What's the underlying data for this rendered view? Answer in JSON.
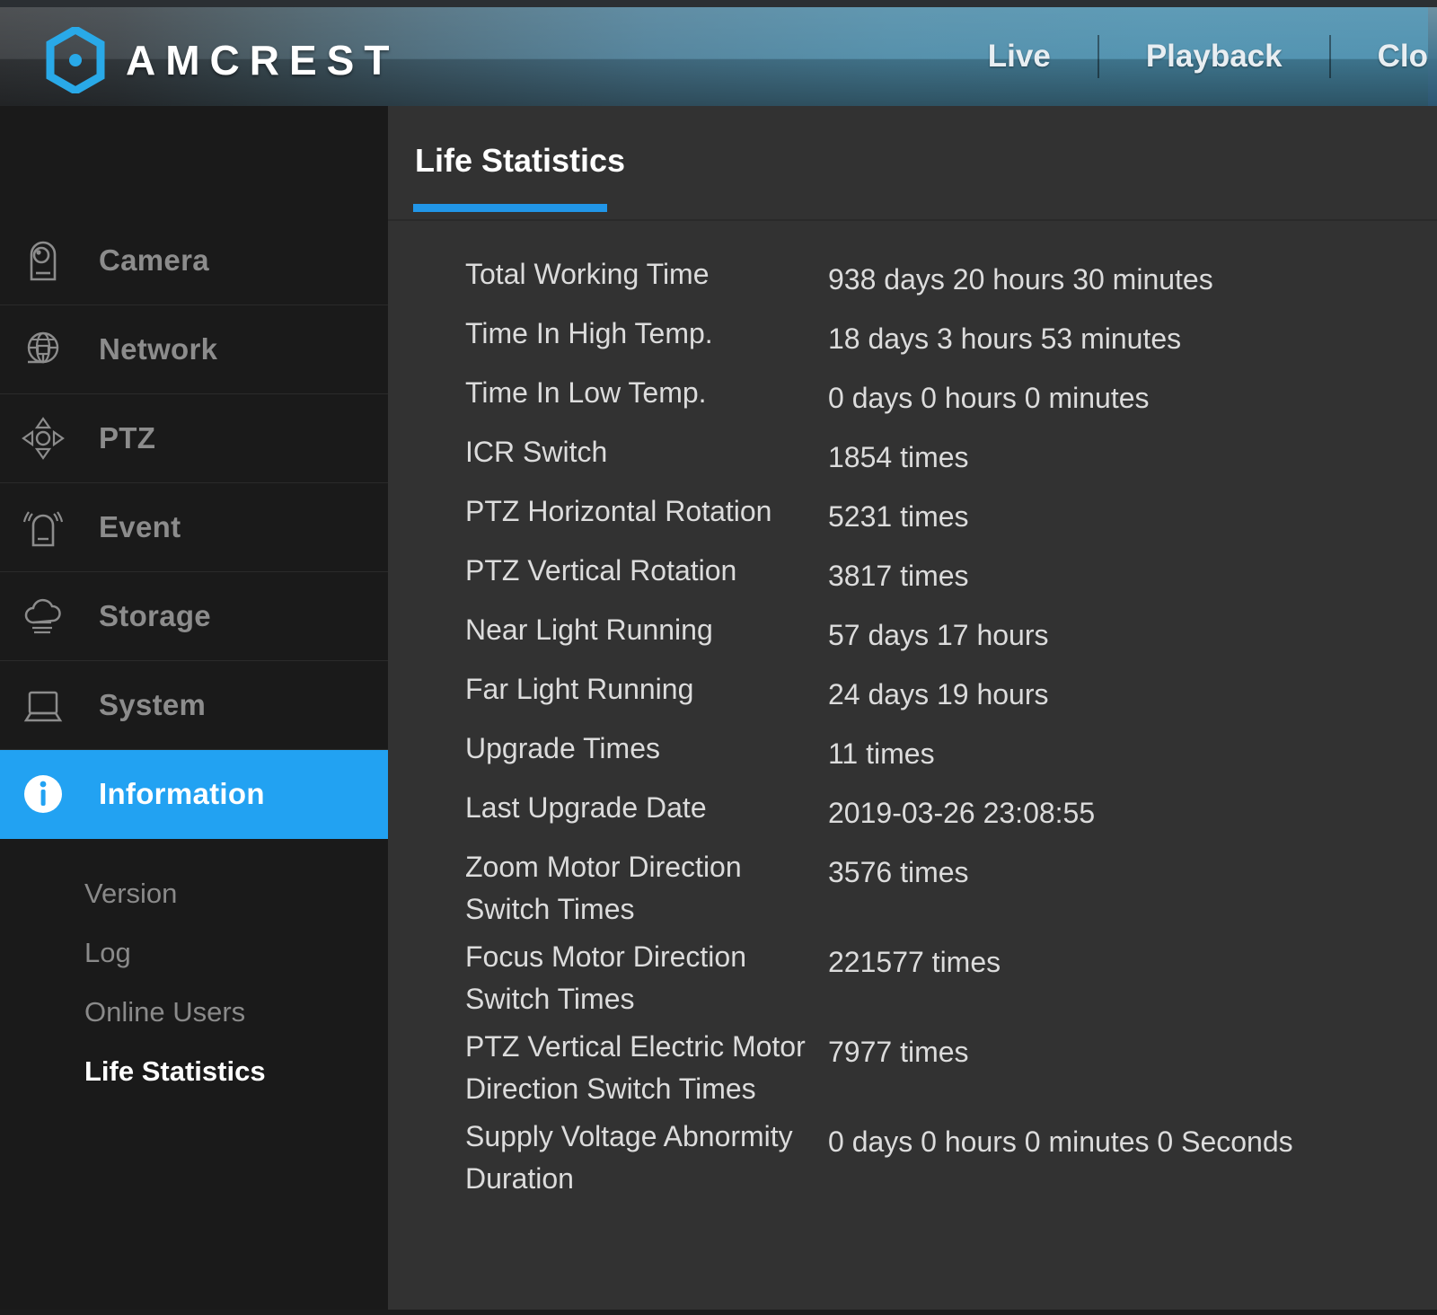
{
  "header": {
    "brand": "AMCREST",
    "logo_icon": "amcrest-hexagon-logo-icon",
    "nav": [
      {
        "label": "Live",
        "icon": "live-nav-item"
      },
      {
        "label": "Playback",
        "icon": "playback-nav-item"
      },
      {
        "label": "Clo",
        "icon": "cloud-nav-item"
      }
    ],
    "accent_color": "#22a2f2"
  },
  "sidebar": {
    "items": [
      {
        "label": "Camera",
        "icon": "camera-icon",
        "active": false
      },
      {
        "label": "Network",
        "icon": "globe-network-icon",
        "active": false
      },
      {
        "label": "PTZ",
        "icon": "ptz-directional-icon",
        "active": false
      },
      {
        "label": "Event",
        "icon": "alarm-bell-icon",
        "active": false
      },
      {
        "label": "Storage",
        "icon": "cloud-storage-icon",
        "active": false
      },
      {
        "label": "System",
        "icon": "monitor-system-icon",
        "active": false
      },
      {
        "label": "Information",
        "icon": "info-circle-icon",
        "active": true
      }
    ],
    "submenu": [
      {
        "label": "Version",
        "active": false
      },
      {
        "label": "Log",
        "active": false
      },
      {
        "label": "Online Users",
        "active": false
      },
      {
        "label": "Life Statistics",
        "active": true
      }
    ]
  },
  "main": {
    "tab_label": "Life Statistics",
    "rows": [
      {
        "label": "Total Working Time",
        "value": "938 days 20 hours 30 minutes"
      },
      {
        "label": "Time In High Temp.",
        "value": "18 days 3 hours 53 minutes"
      },
      {
        "label": "Time In Low Temp.",
        "value": "0 days 0 hours 0 minutes"
      },
      {
        "label": "ICR Switch",
        "value": "1854 times"
      },
      {
        "label": "PTZ Horizontal Rotation",
        "value": "5231 times"
      },
      {
        "label": "PTZ Vertical Rotation",
        "value": "3817 times"
      },
      {
        "label": "Near Light Running",
        "value": "57 days 17 hours"
      },
      {
        "label": "Far Light Running",
        "value": "24 days 19 hours"
      },
      {
        "label": "Upgrade Times",
        "value": "11 times"
      },
      {
        "label": "Last Upgrade Date",
        "value": "2019-03-26 23:08:55"
      },
      {
        "label": "Zoom Motor Direction Switch Times",
        "value": "3576 times"
      },
      {
        "label": "Focus Motor Direction Switch Times",
        "value": "221577 times"
      },
      {
        "label": "PTZ Vertical Electric Motor Direction Switch Times",
        "value": "7977 times"
      },
      {
        "label": "Supply Voltage Abnormity Duration",
        "value": "0 days 0 hours 0 minutes 0 Seconds"
      }
    ]
  }
}
